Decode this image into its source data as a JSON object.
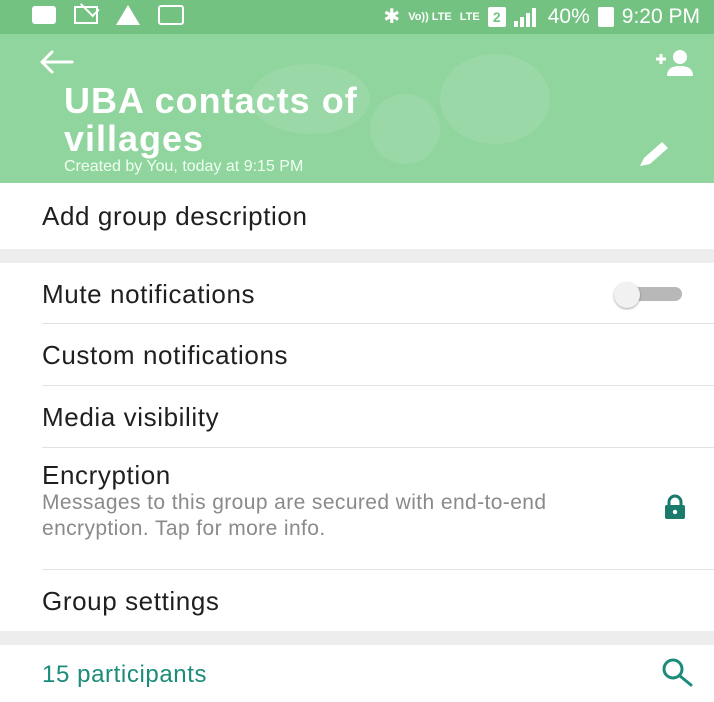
{
  "status_bar": {
    "volte": "Vo)) LTE",
    "lte": "LTE",
    "sim_slot": "2",
    "battery": "40%",
    "time": "9:20 PM"
  },
  "header": {
    "title": "UBA contacts of villages",
    "subtitle": "Created by You, today at 9:15 PM"
  },
  "description": {
    "label": "Add group description"
  },
  "settings": {
    "mute": {
      "label": "Mute notifications",
      "enabled": false
    },
    "custom": {
      "label": "Custom notifications"
    },
    "media": {
      "label": "Media visibility"
    },
    "encryption": {
      "label": "Encryption",
      "description": "Messages to this group are secured with end-to-end encryption. Tap for more info."
    },
    "group_settings": {
      "label": "Group settings"
    }
  },
  "participants": {
    "label": "15 participants"
  },
  "colors": {
    "header": "#8fd59d",
    "status_bar": "#74c282",
    "accent": "#1c8c7a",
    "lock": "#1a7a6c"
  },
  "icons": [
    "back-arrow-icon",
    "add-participant-icon",
    "edit-pencil-icon",
    "lock-icon",
    "search-icon"
  ]
}
